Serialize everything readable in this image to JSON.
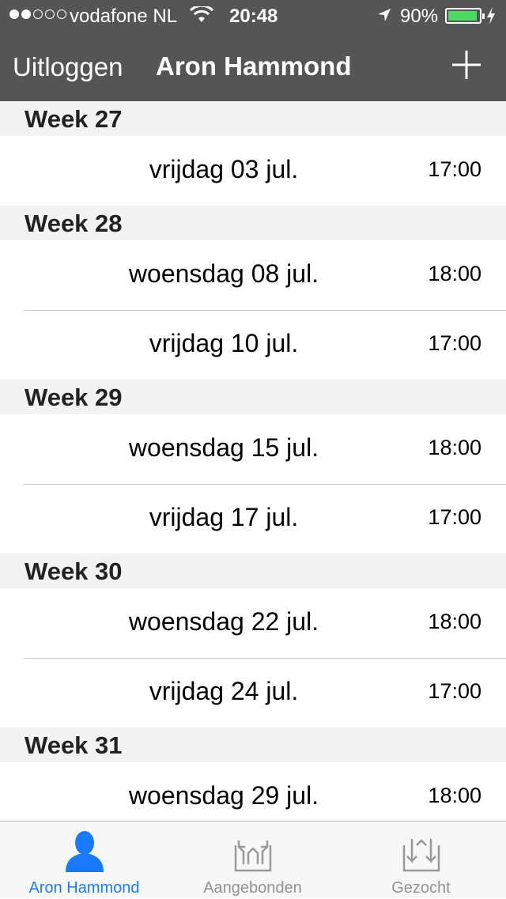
{
  "status": {
    "carrier": "vodafone NL",
    "time": "20:48",
    "battery": "90%",
    "signal_bars": 2
  },
  "nav": {
    "logout_label": "Uitloggen",
    "title": "Aron Hammond"
  },
  "weeks": [
    {
      "label": "Week 27",
      "items": [
        {
          "date": "vrijdag 03 jul.",
          "time": "17:00"
        }
      ]
    },
    {
      "label": "Week 28",
      "items": [
        {
          "date": "woensdag 08 jul.",
          "time": "18:00"
        },
        {
          "date": "vrijdag 10 jul.",
          "time": "17:00"
        }
      ]
    },
    {
      "label": "Week 29",
      "items": [
        {
          "date": "woensdag 15 jul.",
          "time": "18:00"
        },
        {
          "date": "vrijdag 17 jul.",
          "time": "17:00"
        }
      ]
    },
    {
      "label": "Week 30",
      "items": [
        {
          "date": "woensdag 22 jul.",
          "time": "18:00"
        },
        {
          "date": "vrijdag 24 jul.",
          "time": "17:00"
        }
      ]
    },
    {
      "label": "Week 31",
      "items": [
        {
          "date": "woensdag 29 jul.",
          "time": "18:00"
        }
      ]
    }
  ],
  "tabs": [
    {
      "label": "Aron Hammond",
      "icon": "person-icon",
      "active": true
    },
    {
      "label": "Aangebonden",
      "icon": "arrows-up-icon",
      "active": false
    },
    {
      "label": "Gezocht",
      "icon": "arrows-down-icon",
      "active": false
    }
  ],
  "colors": {
    "navbar": "#555555",
    "accent": "#1a7aff",
    "battery": "#4cd964"
  }
}
